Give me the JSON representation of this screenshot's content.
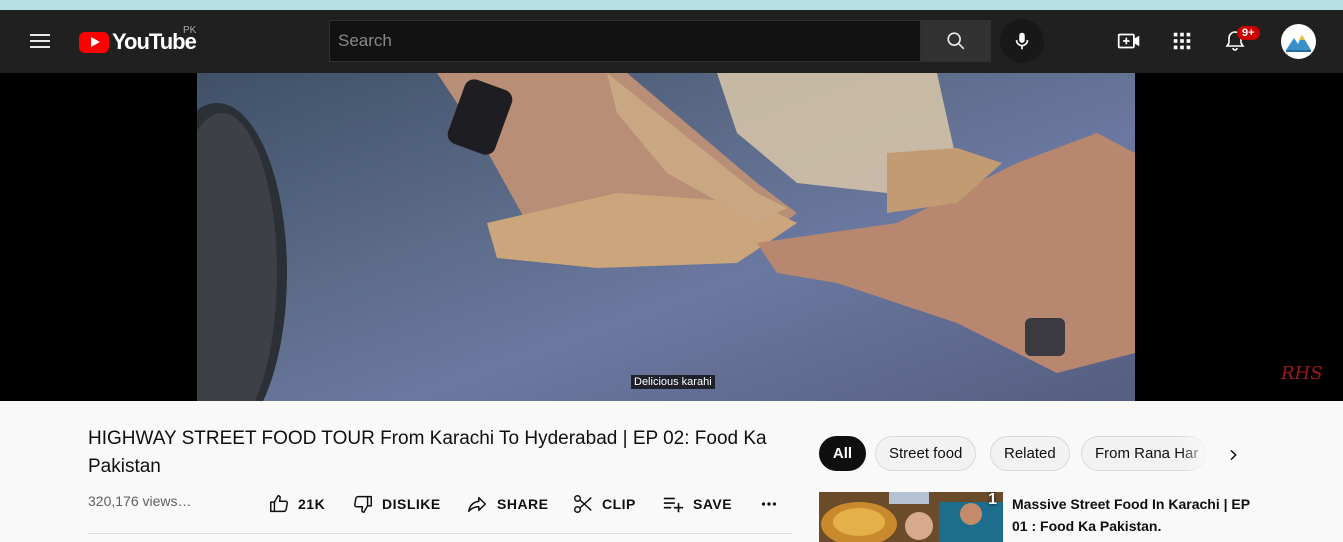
{
  "header": {
    "logo_text": "YouTube",
    "country_code": "PK",
    "search_placeholder": "Search",
    "notification_count": "9+"
  },
  "player": {
    "caption": "Delicious karahi",
    "watermark": "RHS"
  },
  "video": {
    "title": "HIGHWAY STREET FOOD TOUR From Karachi To Hyderabad | EP 02: Food Ka Pakistan",
    "views": "320,176 views…",
    "actions": {
      "like": "21K",
      "dislike": "DISLIKE",
      "share": "SHARE",
      "clip": "CLIP",
      "save": "SAVE"
    }
  },
  "sidebar": {
    "chips": [
      "All",
      "Street food",
      "Related",
      "From Rana Har"
    ],
    "recommendations": [
      {
        "title": "Massive Street Food In Karachi | EP 01 : Food Ka Pakistan.",
        "thumb_number": "1"
      }
    ]
  },
  "colors": {
    "masthead": "#202020",
    "youtube_red": "#ff0000",
    "badge": "#cc0000",
    "top_strip": "#b6dfe6"
  }
}
